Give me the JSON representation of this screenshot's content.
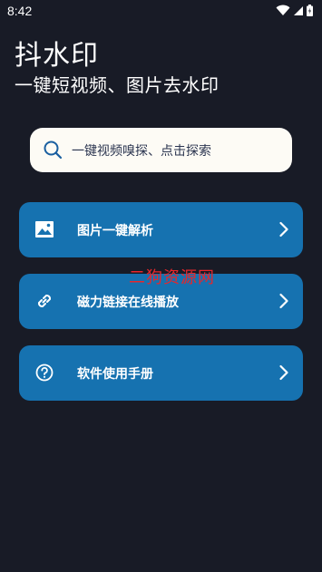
{
  "status_bar": {
    "time": "8:42",
    "icons": [
      "wifi-icon",
      "signal-icon",
      "battery-icon"
    ]
  },
  "header": {
    "title": "抖水印",
    "subtitle": "一键短视频、图片去水印"
  },
  "search": {
    "placeholder": "一键视频嗅探、点击探索",
    "icon": "search-icon"
  },
  "menu": {
    "items": [
      {
        "label": "图片一键解析",
        "icon": "image-icon"
      },
      {
        "label": "磁力链接在线播放",
        "icon": "link-icon"
      },
      {
        "label": "软件使用手册",
        "icon": "help-circle-icon"
      }
    ]
  },
  "watermark": "二狗资源网",
  "colors": {
    "background": "#181b26",
    "card": "#1672b0",
    "search_bg": "#fdfbf5",
    "watermark": "#e8262b"
  }
}
